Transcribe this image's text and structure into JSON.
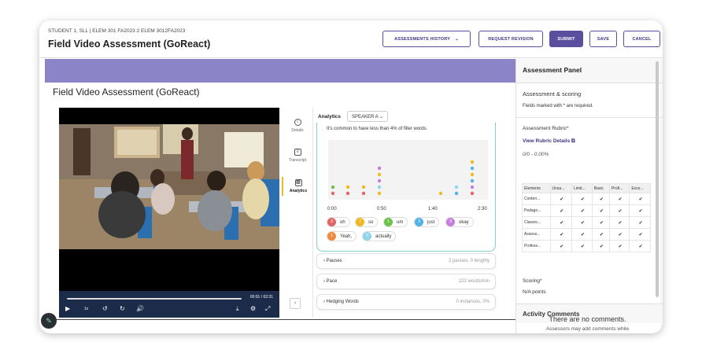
{
  "header": {
    "breadcrumb": "STUDENT 1, SLL | ELEM 301 FA2023 2 ELEM 3012FA2023",
    "title": "Field Video Assessment (GoReact)",
    "buttons": {
      "history": "ASSESSMENTS HISTORY",
      "revision": "REQUEST REVISION",
      "submit": "SUBMIT",
      "save": "SAVE",
      "cancel": "CANCEL"
    }
  },
  "main": {
    "section_title": "Field Video Assessment (GoReact)",
    "player": {
      "time": "00:01 / 02:31",
      "speed": "1x"
    },
    "side_tabs": {
      "details": "Details",
      "transcript": "Transcript",
      "analytics": "Analytics"
    },
    "analytics": {
      "label": "Analytics",
      "speaker": "SPEAKER A",
      "note": "It's common to have less than 4% of filler words.",
      "timeline_labels": [
        "0:00",
        "0:50",
        "1:40",
        "2:30"
      ],
      "filler_words": [
        {
          "count": "3",
          "word": "oh",
          "color": "#e06666"
        },
        {
          "count": "7",
          "word": "so",
          "color": "#f2b824"
        },
        {
          "count": "1",
          "word": "um",
          "color": "#6cc24a"
        },
        {
          "count": "3",
          "word": "just",
          "color": "#4fb3e8"
        },
        {
          "count": "3",
          "word": "okay",
          "color": "#c77ddb"
        },
        {
          "count": "1",
          "word": "Yeah,",
          "color": "#f08a3c"
        },
        {
          "count": "2",
          "word": "actually",
          "color": "#8fd3ee"
        }
      ],
      "accordions": [
        {
          "label": "Pauses",
          "value": "2 pauses, 0 lengthy"
        },
        {
          "label": "Pace",
          "value": "222 words/min"
        },
        {
          "label": "Hedging Words",
          "value": "0 instances, 0%"
        }
      ]
    }
  },
  "panel": {
    "title": "Assessment Panel",
    "scoring_heading": "Assessment & scoring",
    "required_note": "Fields marked with * are required.",
    "rubric_label": "Assessment Rubric*",
    "rubric_link": "View Rubric Details",
    "rubric_score": "0/0 - 0.00%",
    "rubric_columns": [
      "Elements",
      "Unsa...",
      "Limit...",
      "Basic",
      "Profi...",
      "Exce..."
    ],
    "rubric_rows": [
      "Conten...",
      "Pedago...",
      "Classro...",
      "Assess...",
      "Profess..."
    ],
    "scoring_label": "Scoring*",
    "scoring_value": "N/A points",
    "comments_heading": "Activity Comments",
    "no_comments": "There are no comments.",
    "comments_hint": "Assessors may add comments while"
  }
}
